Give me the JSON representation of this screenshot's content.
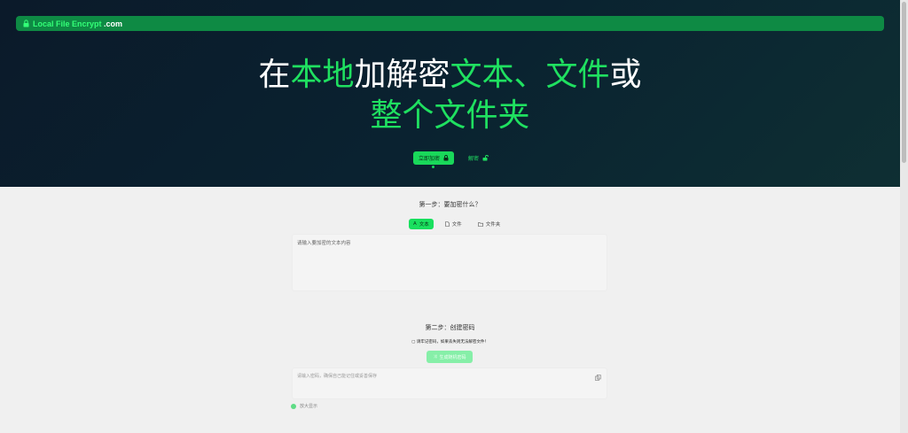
{
  "brand": {
    "name": "Local File Encrypt",
    "domain": ".com"
  },
  "headline": {
    "line1": [
      {
        "text": "在",
        "accent": false
      },
      {
        "text": "本地",
        "accent": true
      },
      {
        "text": "加解密",
        "accent": false
      },
      {
        "text": "文本、文件",
        "accent": true
      },
      {
        "text": "或",
        "accent": false
      }
    ],
    "line2": [
      {
        "text": "整个文件夹",
        "accent": true
      }
    ]
  },
  "modes": {
    "encrypt_label": "立即加密",
    "decrypt_label": "解密"
  },
  "step1": {
    "title": "第一步：要加密什么？",
    "tabs": [
      {
        "label": "文本",
        "active": true
      },
      {
        "label": "文件",
        "active": false
      },
      {
        "label": "文件夹",
        "active": false
      }
    ],
    "textarea_placeholder": "请输入要加密的文本内容"
  },
  "step2": {
    "title": "第二步：创建密码",
    "warning": "请牢记密码，如果丢失则无法解密文件！",
    "generate_label": "生成随机密码",
    "password_placeholder": "请输入密码，确保自己能记住或妥善保存",
    "show_toggle_label": "放大显示"
  },
  "colors": {
    "accent": "#1fe060",
    "hero_bg": "#0b1a2a",
    "topbar": "#0e8a44"
  }
}
